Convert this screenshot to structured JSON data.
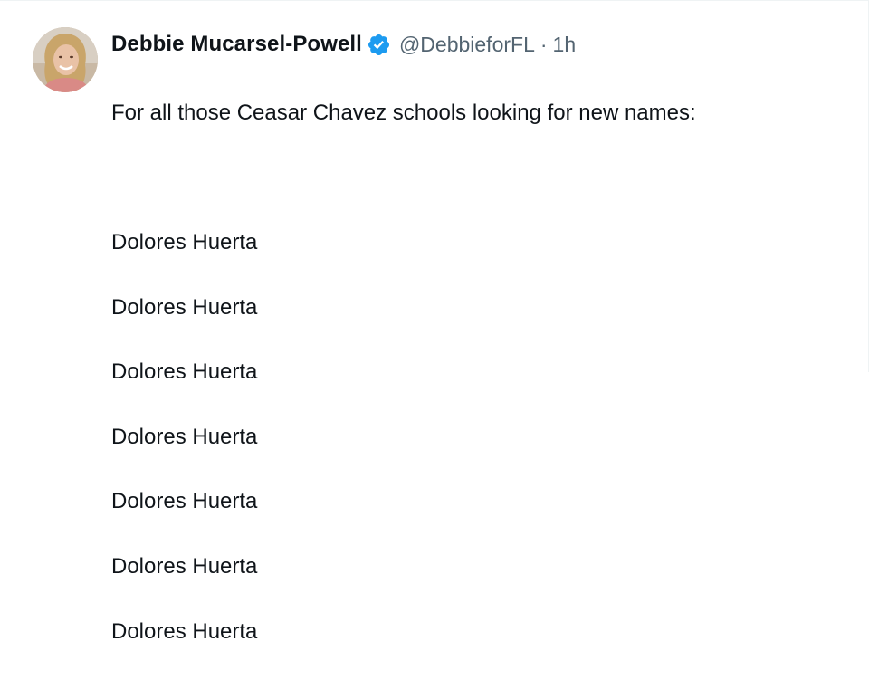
{
  "tweet": {
    "author": {
      "name": "Debbie Mucarsel-Powell",
      "handle": "@DebbieforFL",
      "verified_icon": "verified-badge-icon",
      "verified_color": "#1d9bf0"
    },
    "separator": "·",
    "time": "1h",
    "text": {
      "intro": "For all those Ceasar Chavez schools looking for new names:",
      "list": [
        "Dolores Huerta",
        "Dolores Huerta",
        "Dolores Huerta",
        "Dolores Huerta",
        "Dolores Huerta",
        "Dolores Huerta",
        "Dolores Huerta"
      ]
    }
  }
}
